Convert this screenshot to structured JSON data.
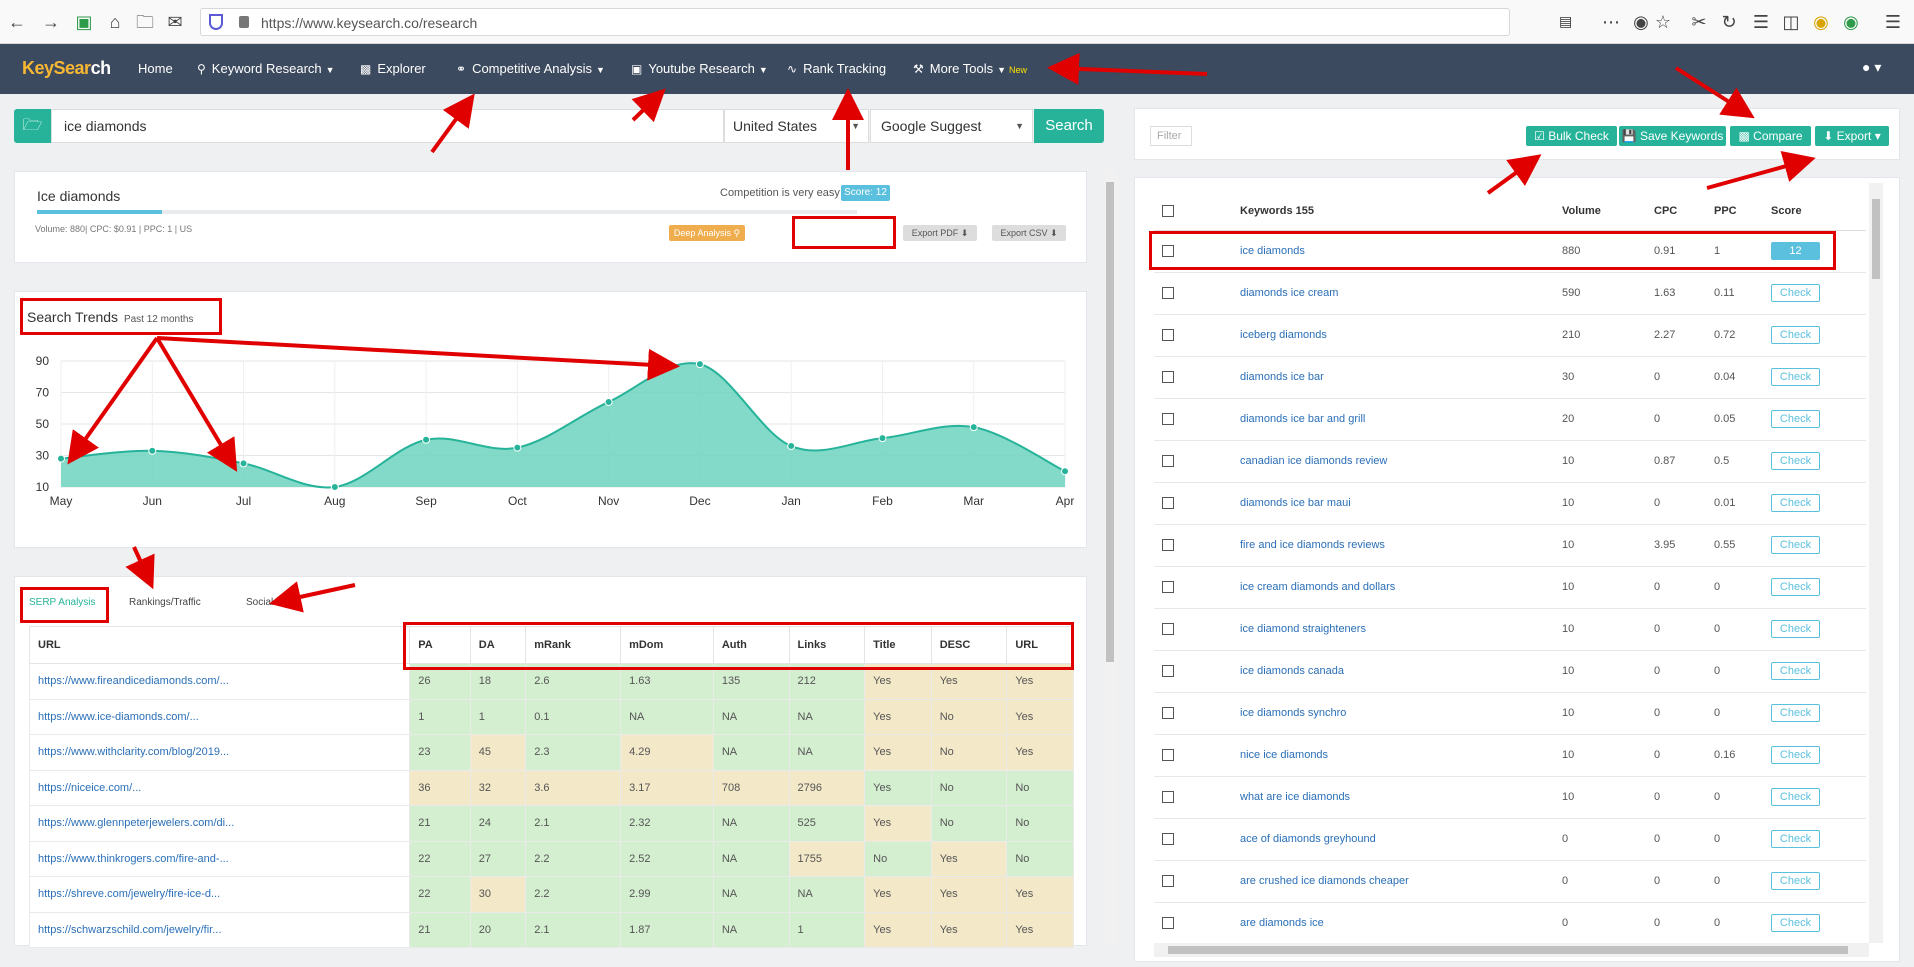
{
  "browser": {
    "url": "https://www.keysearch.co/research"
  },
  "nav": {
    "logo_part1": "KeySear",
    "logo_part2": "ch",
    "items": [
      {
        "label": "Home"
      },
      {
        "label": "Keyword Research"
      },
      {
        "label": "Explorer"
      },
      {
        "label": "Competitive Analysis"
      },
      {
        "label": "Youtube Research"
      },
      {
        "label": "Rank Tracking"
      },
      {
        "label": "More Tools"
      }
    ],
    "new_badge": "New"
  },
  "search": {
    "query": "ice diamonds",
    "country": "United States",
    "source": "Google Suggest",
    "button": "Search"
  },
  "keyword_card": {
    "title": "Ice diamonds",
    "meta": "Volume: 880| CPC: $0.91 | PPC: 1 | US",
    "competition": "Competition is very easy",
    "score": "Score: 12",
    "deep_analysis": "Deep Analysis",
    "export_pdf": "Export PDF",
    "export_csv": "Export CSV"
  },
  "trends": {
    "title": "Search Trends",
    "subtitle": "Past 12 months"
  },
  "chart_data": {
    "type": "area",
    "x": [
      "May",
      "Jun",
      "Jul",
      "Aug",
      "Sep",
      "Oct",
      "Nov",
      "Dec",
      "Jan",
      "Feb",
      "Mar",
      "Apr"
    ],
    "series": [
      {
        "values": [
          28,
          33,
          25,
          10,
          40,
          35,
          64,
          88,
          36,
          41,
          48,
          20
        ]
      }
    ],
    "ylim": [
      10,
      90
    ],
    "yticks": [
      10,
      30,
      50,
      70,
      90
    ],
    "color": "#6dd3be"
  },
  "serp_tabs": [
    "SERP Analysis",
    "Rankings/Traffic",
    "Social"
  ],
  "serp_table": {
    "headers": [
      "URL",
      "PA",
      "DA",
      "mRank",
      "mDom",
      "Auth",
      "Links",
      "Title",
      "DESC",
      "URL"
    ],
    "rows": [
      [
        "https://www.fireandicediamonds.com/...",
        "26",
        "18",
        "2.6",
        "1.63",
        "135",
        "212",
        "Yes",
        "Yes",
        "Yes"
      ],
      [
        "https://www.ice-diamonds.com/...",
        "1",
        "1",
        "0.1",
        "NA",
        "NA",
        "NA",
        "Yes",
        "No",
        "Yes"
      ],
      [
        "https://www.withclarity.com/blog/2019...",
        "23",
        "45",
        "2.3",
        "4.29",
        "NA",
        "NA",
        "Yes",
        "No",
        "Yes"
      ],
      [
        "https://niceice.com/...",
        "36",
        "32",
        "3.6",
        "3.17",
        "708",
        "2796",
        "Yes",
        "No",
        "No"
      ],
      [
        "https://www.glennpeterjewelers.com/di...",
        "21",
        "24",
        "2.1",
        "2.32",
        "NA",
        "525",
        "Yes",
        "No",
        "No"
      ],
      [
        "https://www.thinkrogers.com/fire-and-...",
        "22",
        "27",
        "2.2",
        "2.52",
        "NA",
        "1755",
        "No",
        "Yes",
        "No"
      ],
      [
        "https://shreve.com/jewelry/fire-ice-d...",
        "22",
        "30",
        "2.2",
        "2.99",
        "NA",
        "NA",
        "Yes",
        "Yes",
        "Yes"
      ],
      [
        "https://schwarzschild.com/jewelry/fir...",
        "21",
        "20",
        "2.1",
        "1.87",
        "NA",
        "1",
        "Yes",
        "Yes",
        "Yes"
      ]
    ],
    "colors": [
      [
        "g",
        "g",
        "g",
        "g",
        "g",
        "g",
        "y",
        "y",
        "y"
      ],
      [
        "g",
        "g",
        "g",
        "g",
        "g",
        "g",
        "y",
        "y",
        "y"
      ],
      [
        "g",
        "y",
        "g",
        "y",
        "g",
        "g",
        "y",
        "y",
        "y"
      ],
      [
        "y",
        "y",
        "y",
        "y",
        "y",
        "y",
        "g",
        "g",
        "g"
      ],
      [
        "g",
        "g",
        "g",
        "g",
        "g",
        "g",
        "y",
        "g",
        "g"
      ],
      [
        "g",
        "g",
        "g",
        "g",
        "g",
        "y",
        "g",
        "y",
        "g"
      ],
      [
        "g",
        "y",
        "g",
        "g",
        "g",
        "g",
        "y",
        "y",
        "y"
      ],
      [
        "g",
        "g",
        "g",
        "g",
        "g",
        "g",
        "y",
        "y",
        "y"
      ]
    ]
  },
  "right_panel": {
    "filter_placeholder": "Filter",
    "bulk_check": "Bulk Check",
    "save_keywords": "Save Keywords",
    "compare": "Compare",
    "export": "Export",
    "headers": [
      "Keywords 155",
      "Volume",
      "CPC",
      "PPC",
      "Score"
    ],
    "rows": [
      [
        "ice diamonds",
        "880",
        "0.91",
        "1",
        "12"
      ],
      [
        "diamonds ice cream",
        "590",
        "1.63",
        "0.11",
        "Check"
      ],
      [
        "iceberg diamonds",
        "210",
        "2.27",
        "0.72",
        "Check"
      ],
      [
        "diamonds ice bar",
        "30",
        "0",
        "0.04",
        "Check"
      ],
      [
        "diamonds ice bar and grill",
        "20",
        "0",
        "0.05",
        "Check"
      ],
      [
        "canadian ice diamonds review",
        "10",
        "0.87",
        "0.5",
        "Check"
      ],
      [
        "diamonds ice bar maui",
        "10",
        "0",
        "0.01",
        "Check"
      ],
      [
        "fire and ice diamonds reviews",
        "10",
        "3.95",
        "0.55",
        "Check"
      ],
      [
        "ice cream diamonds and dollars",
        "10",
        "0",
        "0",
        "Check"
      ],
      [
        "ice diamond straighteners",
        "10",
        "0",
        "0",
        "Check"
      ],
      [
        "ice diamonds canada",
        "10",
        "0",
        "0",
        "Check"
      ],
      [
        "ice diamonds synchro",
        "10",
        "0",
        "0",
        "Check"
      ],
      [
        "nice ice diamonds",
        "10",
        "0",
        "0.16",
        "Check"
      ],
      [
        "what are ice diamonds",
        "10",
        "0",
        "0",
        "Check"
      ],
      [
        "ace of diamonds greyhound",
        "0",
        "0",
        "0",
        "Check"
      ],
      [
        "are crushed ice diamonds cheaper",
        "0",
        "0",
        "0",
        "Check"
      ],
      [
        "are diamonds ice",
        "0",
        "0",
        "0",
        "Check"
      ]
    ]
  }
}
